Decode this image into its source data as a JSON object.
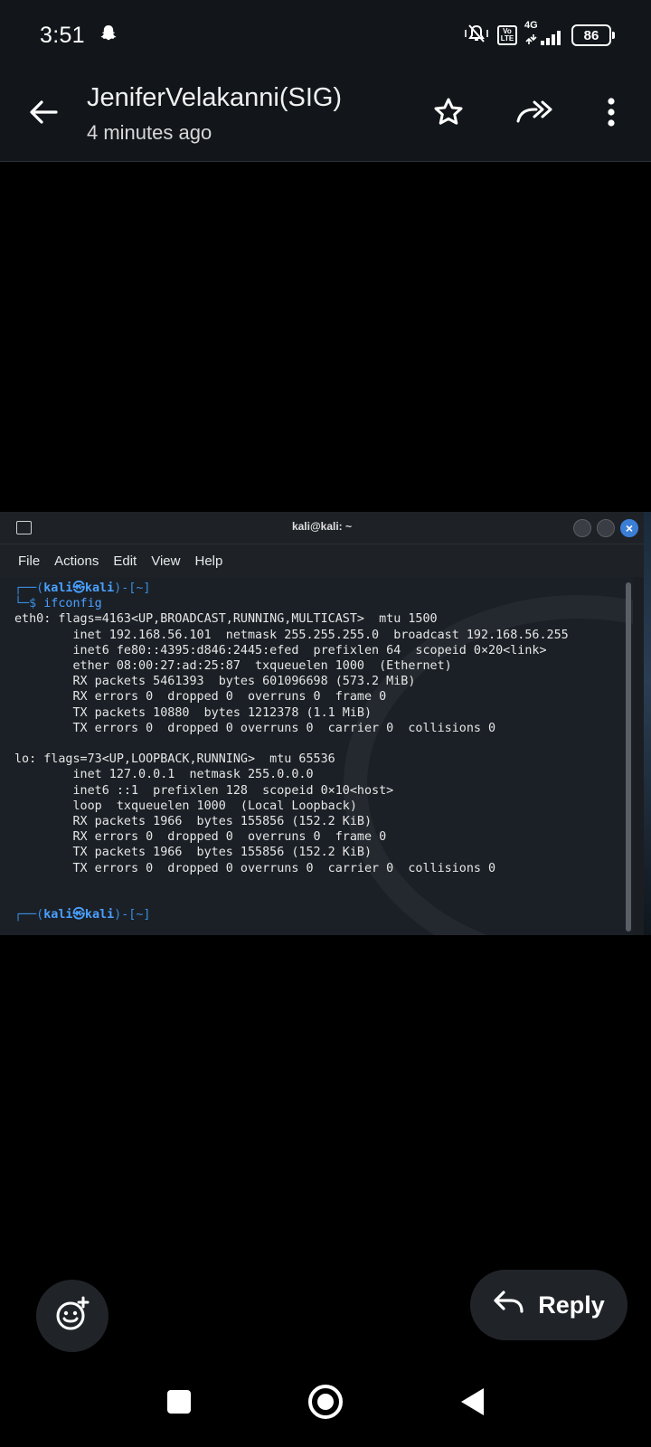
{
  "status_bar": {
    "time": "3:51",
    "network": "4G",
    "lte_top": "Vo",
    "lte_bottom": "LTE",
    "battery": "86"
  },
  "header": {
    "sender": "JeniferVelakanni(SIG)",
    "time_ago": "4 minutes ago"
  },
  "terminal": {
    "window_title": "kali@kali: ~",
    "menu": [
      "File",
      "Actions",
      "Edit",
      "View",
      "Help"
    ],
    "prompt_open": "┌──(",
    "prompt_user": "kali㉿kali",
    "prompt_close": ")-[~]",
    "prompt_dollar": "└─$ ",
    "command": "ifconfig",
    "output": [
      "eth0: flags=4163<UP,BROADCAST,RUNNING,MULTICAST>  mtu 1500",
      "        inet 192.168.56.101  netmask 255.255.255.0  broadcast 192.168.56.255",
      "        inet6 fe80::4395:d846:2445:efed  prefixlen 64  scopeid 0×20<link>",
      "        ether 08:00:27:ad:25:87  txqueuelen 1000  (Ethernet)",
      "        RX packets 5461393  bytes 601096698 (573.2 MiB)",
      "        RX errors 0  dropped 0  overruns 0  frame 0",
      "        TX packets 10880  bytes 1212378 (1.1 MiB)",
      "        TX errors 0  dropped 0 overruns 0  carrier 0  collisions 0",
      "",
      "lo: flags=73<UP,LOOPBACK,RUNNING>  mtu 65536",
      "        inet 127.0.0.1  netmask 255.0.0.0",
      "        inet6 ::1  prefixlen 128  scopeid 0×10<host>",
      "        loop  txqueuelen 1000  (Local Loopback)",
      "        RX packets 1966  bytes 155856 (152.2 KiB)",
      "        RX errors 0  dropped 0  overruns 0  frame 0",
      "        TX packets 1966  bytes 155856 (152.2 KiB)",
      "        TX errors 0  dropped 0 overruns 0  carrier 0  collisions 0",
      "",
      ""
    ]
  },
  "actions": {
    "reply_label": "Reply"
  },
  "icons": {
    "status": [
      "snapchat-icon",
      "mute-icon",
      "signal-icon",
      "battery-icon"
    ],
    "header": [
      "back-arrow-icon",
      "star-icon",
      "forward-icon",
      "more-vert-icon"
    ],
    "bottom": [
      "emoji-add-icon",
      "reply-icon"
    ],
    "nav": [
      "recents-icon",
      "home-icon",
      "back-icon"
    ]
  },
  "colors": {
    "header_bg": "#12161a",
    "button_bg": "#202428",
    "terminal_prompt": "#4aa0ff",
    "terminal_close": "#3b7ed6"
  }
}
